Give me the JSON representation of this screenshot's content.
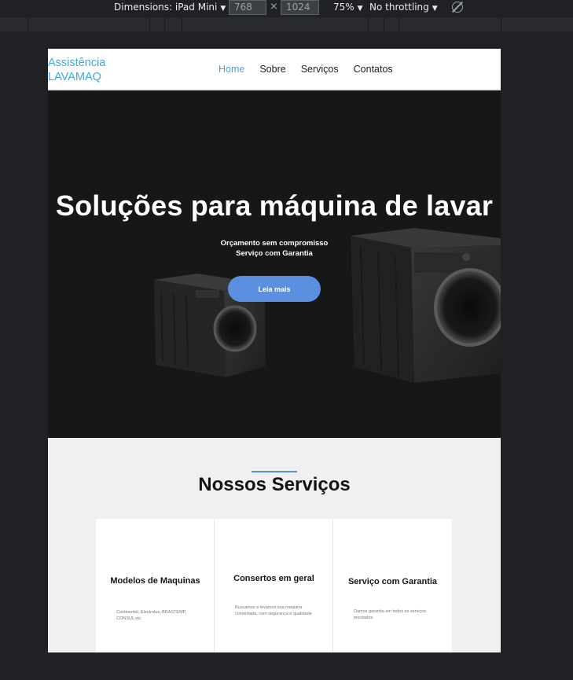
{
  "devtools": {
    "dimensions_label": "Dimensions: iPad Mini",
    "width": "768",
    "height": "1024",
    "zoom": "75%",
    "throttling": "No throttling",
    "separator": "×"
  },
  "site": {
    "brand_line1": "Assistência",
    "brand_line2": "LAVAMAQ",
    "nav": [
      "Home",
      "Sobre",
      "Serviços",
      "Contatos"
    ],
    "active_nav": "Home"
  },
  "hero": {
    "title": "Soluções para máquina de lavar",
    "subtitle_line1": "Orçamento sem compromisso",
    "subtitle_line2": "Serviço com Garantia",
    "button_label": "Leia mais"
  },
  "services": {
    "title": "Nossos Serviços",
    "accent_color": "#5b8fe0",
    "cards": [
      {
        "title": "Modelos de Maquinas",
        "desc": "Continental, Electrolux, BRASTEMP, CONSUL etc"
      },
      {
        "title": "Consertos em geral",
        "desc": "Buscamos e levamos sua maquina consertada, com segurança e qualidade"
      },
      {
        "title": "Serviço com Garantia",
        "desc": "Damos garantia em todos os serviços prestados"
      }
    ]
  },
  "colors": {
    "brand": "#3fa9d9",
    "hero_bg": "#171718",
    "button": "#5b8fe0"
  }
}
